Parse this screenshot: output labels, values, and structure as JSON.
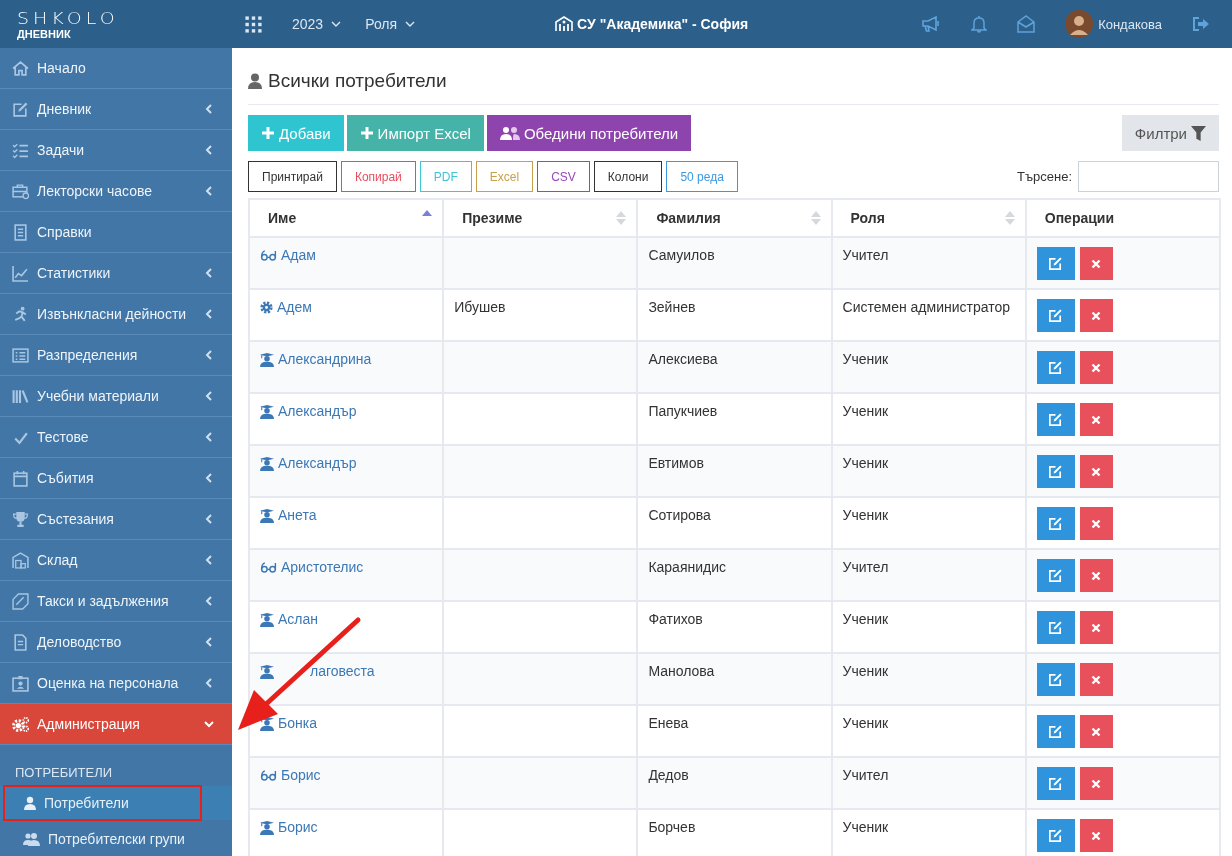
{
  "header": {
    "logo": "SHKOLO",
    "logo_subtitle": "ДНЕВНИК",
    "year": "2023",
    "role": "Роля",
    "school": "СУ \"Академика\" - София",
    "user": "Кондакова"
  },
  "sidebar": {
    "items": [
      {
        "label": "Начало",
        "kind": "link",
        "selected": false
      },
      {
        "label": "Дневник",
        "kind": "menu",
        "selected": false,
        "expanded": false
      },
      {
        "label": "Задачи",
        "kind": "menu",
        "selected": false,
        "expanded": false
      },
      {
        "label": "Лекторски часове",
        "kind": "menu",
        "selected": false,
        "expanded": false
      },
      {
        "label": "Справки",
        "kind": "link",
        "selected": false
      },
      {
        "label": "Статистики",
        "kind": "menu",
        "selected": false,
        "expanded": false
      },
      {
        "label": "Извънкласни дейности",
        "kind": "menu",
        "selected": false,
        "expanded": false
      },
      {
        "label": "Разпределения",
        "kind": "menu",
        "selected": false,
        "expanded": false
      },
      {
        "label": "Учебни материали",
        "kind": "menu",
        "selected": false,
        "expanded": false
      },
      {
        "label": "Тестове",
        "kind": "menu",
        "selected": false,
        "expanded": false
      },
      {
        "label": "Събития",
        "kind": "menu",
        "selected": false,
        "expanded": false
      },
      {
        "label": "Състезания",
        "kind": "menu",
        "selected": false,
        "expanded": false
      },
      {
        "label": "Склад",
        "kind": "menu",
        "selected": false,
        "expanded": false
      },
      {
        "label": "Такси и задължения",
        "kind": "menu",
        "selected": false,
        "expanded": false
      },
      {
        "label": "Деловодство",
        "kind": "menu",
        "selected": false,
        "expanded": false
      },
      {
        "label": "Оценка на персонала",
        "kind": "menu",
        "selected": false,
        "expanded": false
      },
      {
        "label": "Администрация",
        "kind": "menu",
        "selected": true,
        "expanded": true
      }
    ],
    "section": "ПОТРЕБИТЕЛИ",
    "subitems": [
      {
        "label": "Потребители",
        "kind": "user",
        "selected": true
      },
      {
        "label": "Потребителски групи",
        "kind": "group",
        "selected": false
      }
    ]
  },
  "page": {
    "title": "Всички потребители",
    "actions": [
      {
        "label": "Добави",
        "kind": "add"
      },
      {
        "label": "Импорт Excel",
        "kind": "import"
      },
      {
        "label": "Обедини потребители",
        "kind": "merge"
      }
    ],
    "filter": "Филтри",
    "export_buttons": [
      {
        "label": "Принтирай",
        "color": "#333333"
      },
      {
        "label": "Копирай",
        "color": "#e74c5c"
      },
      {
        "label": "PDF",
        "color": "#3ec5d6"
      },
      {
        "label": "Excel",
        "color": "#c9a04a"
      },
      {
        "label": "CSV",
        "color": "#9a46b8"
      },
      {
        "label": "Колони",
        "color": "#333333"
      },
      {
        "label": "50 реда",
        "color": "#3b98e0"
      }
    ],
    "search_label": "Търсене:"
  },
  "table": {
    "columns": [
      {
        "label": "Име",
        "sortable": true,
        "sorted": true
      },
      {
        "label": "Презиме",
        "sortable": true,
        "sorted": false
      },
      {
        "label": "Фамилия",
        "sortable": true,
        "sorted": false
      },
      {
        "label": "Роля",
        "sortable": true,
        "sorted": false
      },
      {
        "label": "Операции",
        "sortable": false
      }
    ],
    "rows": [
      {
        "kind": "teacher",
        "name": "Адам",
        "last": "Самуилов",
        "role": "Учител"
      },
      {
        "kind": "admin",
        "name": "Адем",
        "middle": "Ибушев",
        "last": "Зейнев",
        "role": "Системен администратор"
      },
      {
        "kind": "student",
        "name": "Александрина",
        "last": "Алексиева",
        "role": "Ученик"
      },
      {
        "kind": "student",
        "name": "Александър",
        "last": "Папукчиев",
        "role": "Ученик"
      },
      {
        "kind": "student",
        "name": "Александър",
        "last": "Евтимов",
        "role": "Ученик"
      },
      {
        "kind": "student",
        "name": "Анета",
        "last": "Сотирова",
        "role": "Ученик"
      },
      {
        "kind": "teacher",
        "name": "Аристотелис",
        "last": "Караянидис",
        "role": "Учител"
      },
      {
        "kind": "student",
        "name": "Аслан",
        "last": "Фатихов",
        "role": "Ученик"
      },
      {
        "kind": "student",
        "name": "лаговеста",
        "covered": true,
        "last": "Манолова",
        "role": "Ученик"
      },
      {
        "kind": "student",
        "name": "Бонка",
        "last": "Енева",
        "role": "Ученик"
      },
      {
        "kind": "teacher",
        "name": "Борис",
        "last": "Дедов",
        "role": "Учител"
      },
      {
        "kind": "student",
        "name": "Борис",
        "last": "Борчев",
        "role": "Ученик"
      }
    ]
  }
}
